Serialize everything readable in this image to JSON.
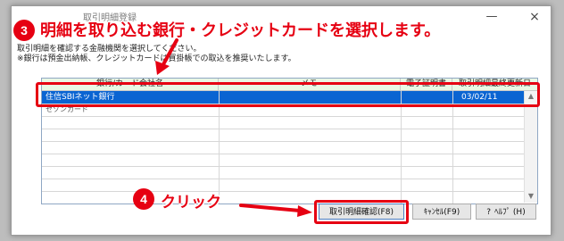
{
  "window": {
    "title": "取引明細登録",
    "minimize_glyph": "—",
    "close_glyph": "×"
  },
  "instructions": {
    "line1": "取引明細を確認する金融機関を選択してください。",
    "line2": "※銀行は預金出納帳、クレジットカードは買掛帳での取込を推奨いたします。"
  },
  "grid": {
    "headers": [
      "銀行/カード会社名",
      "メモ",
      "電子証明書",
      "取引明細最終更新日"
    ],
    "rows": [
      {
        "name": "住信SBIネット銀行",
        "memo": "",
        "cert": "",
        "updated": "03/02/11",
        "selected": true
      },
      {
        "name": "セゾンカード",
        "memo": "",
        "cert": "",
        "updated": "",
        "selected": false
      }
    ]
  },
  "buttons": {
    "confirm": "取引明細確認(F8)",
    "cancel": "ｷｬﾝｾﾙ(F9)",
    "help": "ﾍﾙﾌﾟ (H)"
  },
  "annotations": {
    "step3_number": "3",
    "step3_text": "明細を取り込む銀行・クレジットカードを選択します。",
    "step4_number": "4",
    "step4_text": "クリック",
    "accent_color": "#e60012"
  },
  "icons": {
    "help": "help-question-icon",
    "scroll_up": "chevron-up-icon",
    "scroll_down": "chevron-down-icon"
  }
}
